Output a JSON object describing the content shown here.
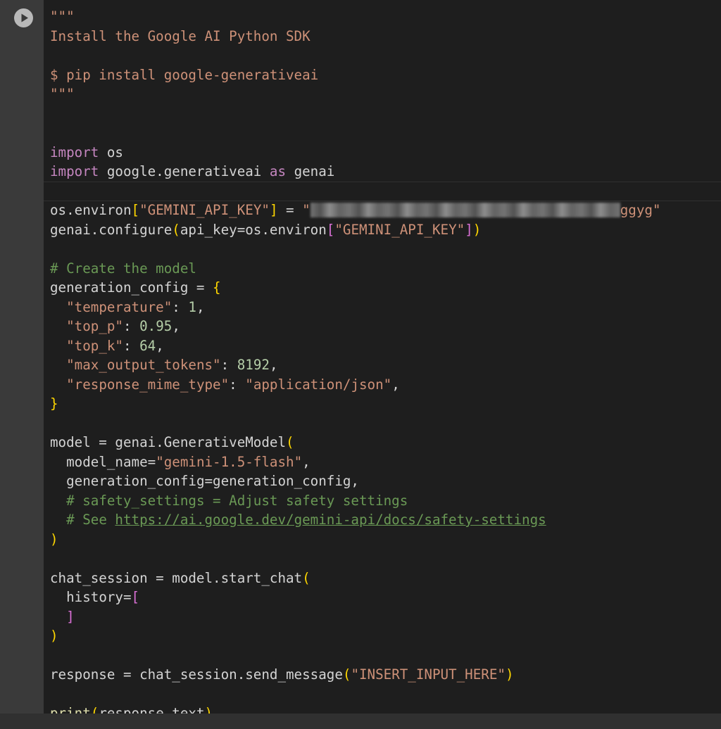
{
  "cell": {
    "run_button_label": "Run cell",
    "colors": {
      "background": "#1e1e1e",
      "gutter": "#3a3a3a",
      "keyword": "#c586c0",
      "function": "#dcdcaa",
      "string": "#ce9178",
      "number": "#b5cea8",
      "comment": "#6a9955",
      "bracket_gold": "#ffd700",
      "bracket_orchid": "#da70d6"
    },
    "code": {
      "docstring_open": "\"\"\"",
      "doc_title": "Install the Google AI Python SDK",
      "doc_command": "$ pip install google-generativeai",
      "docstring_close": "\"\"\"",
      "import_kw": "import",
      "os_module": " os",
      "genai_module": " google.generativeai ",
      "as_kw": "as",
      "genai_alias": " genai",
      "env_target": "os.environ",
      "key_string": "\"GEMINI_API_KEY\"",
      "assign": " = ",
      "api_key_open": "\"",
      "api_key_tail": "ggyg\"",
      "configure_call": "genai.configure",
      "api_key_arg": "api_key=os.environ",
      "comment_create_model": "# Create the model",
      "gen_config_decl": "generation_config = ",
      "open_brace": "{",
      "close_brace": "}",
      "temperature_key": "\"temperature\"",
      "temperature_value": "1",
      "top_p_key": "\"top_p\"",
      "top_p_value": "0.95",
      "top_k_key": "\"top_k\"",
      "top_k_value": "64",
      "max_tokens_key": "\"max_output_tokens\"",
      "max_tokens_value": "8192",
      "mime_key": "\"response_mime_type\"",
      "mime_value": "\"application/json\"",
      "model_assign": "model = genai.",
      "model_class": "GenerativeModel",
      "model_name_arg": "model_name=",
      "model_name_value": "\"gemini-1.5-flash\"",
      "gen_config_arg": "generation_config=generation_config,",
      "comment_safety": "# safety_settings = Adjust safety settings",
      "comment_see": "# See ",
      "safety_url": "https://ai.google.dev/gemini-api/docs/safety-settings",
      "chat_assign": "chat_session = model.start_chat",
      "history_arg": "history=",
      "response_assign": "response = chat_session.send_message",
      "input_value": "\"INSERT_INPUT_HERE\"",
      "print_fn": "print",
      "print_arg": "response.text"
    }
  }
}
